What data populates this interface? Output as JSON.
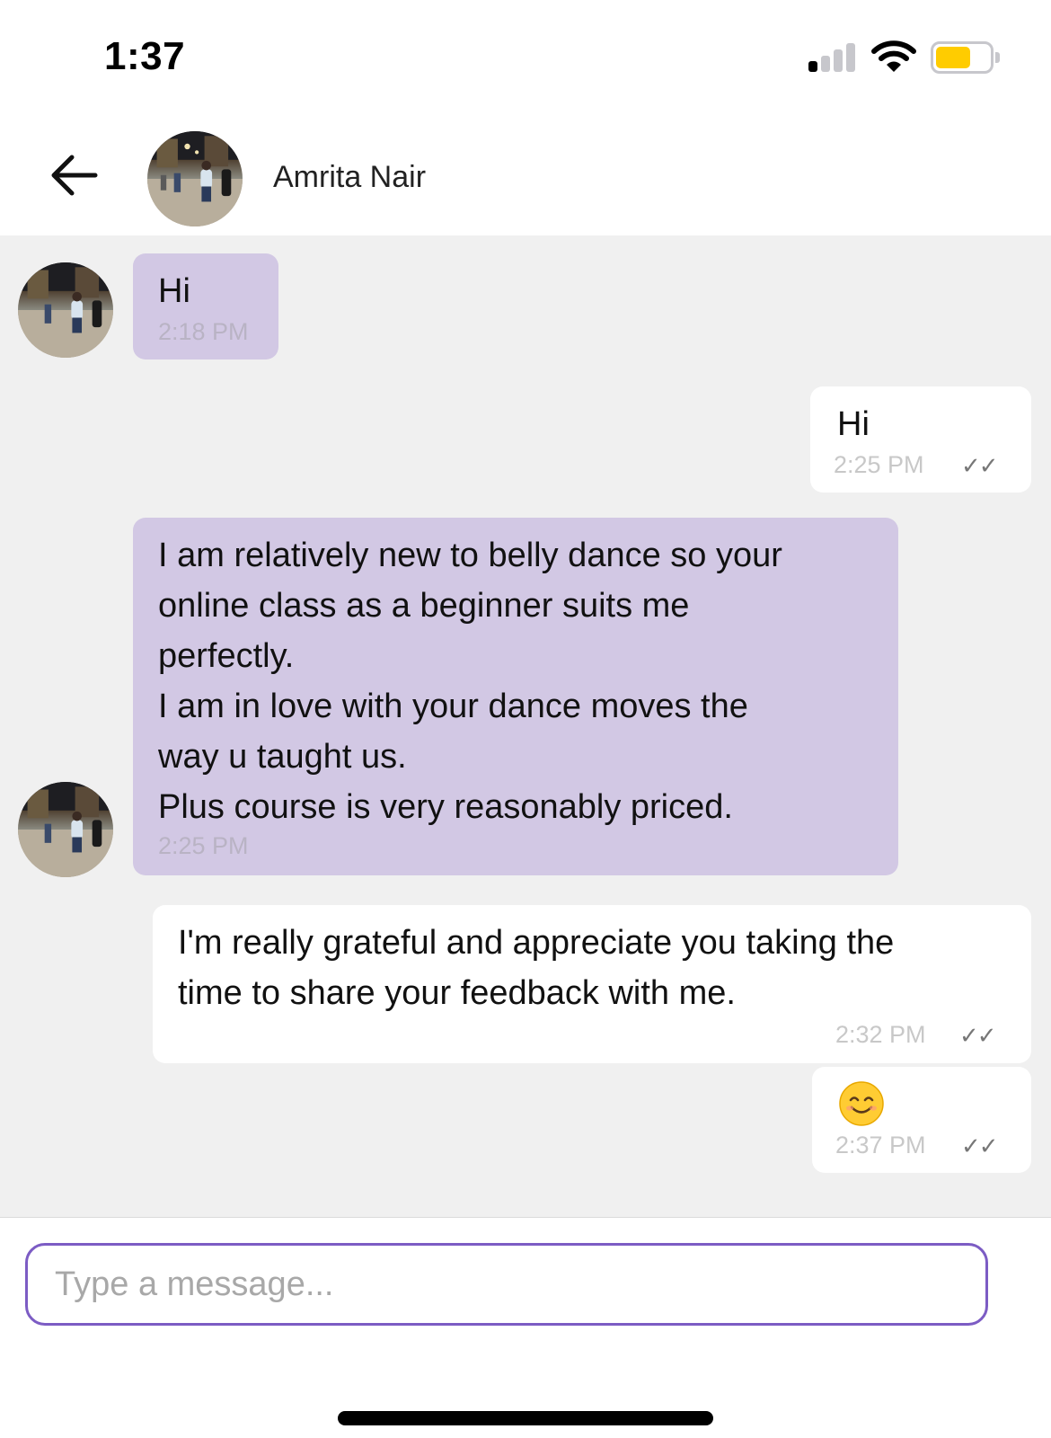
{
  "status_bar": {
    "time": "1:37",
    "signal_bars_on": 1,
    "signal_bars_total": 4,
    "battery_level": 0.65,
    "battery_color": "#ffcc00"
  },
  "header": {
    "back_icon": "arrow-left-icon",
    "contact_name": "Amrita Nair"
  },
  "messages": [
    {
      "direction": "incoming",
      "text": "Hi",
      "time": "2:18 PM"
    },
    {
      "direction": "outgoing",
      "text": "Hi",
      "time": "2:25 PM",
      "status": "✓✓"
    },
    {
      "direction": "incoming",
      "text": "I am relatively new to belly dance so your\nonline class as a beginner suits me\nperfectly.\nI am in love with your dance moves the\nway u taught us.\nPlus course is  very reasonably priced.",
      "time": "2:25 PM"
    },
    {
      "direction": "outgoing",
      "text": "I'm really grateful and appreciate you taking the\ntime to share your feedback with me.",
      "time": "2:32 PM",
      "status": "✓✓"
    },
    {
      "direction": "outgoing",
      "text": "😊",
      "time": "2:37 PM",
      "status": "✓✓"
    }
  ],
  "composer": {
    "placeholder": "Type a message...",
    "value": ""
  },
  "colors": {
    "incoming_bubble": "#d2c8e4",
    "outgoing_bubble": "#ffffff",
    "chat_background": "#f0f0f0",
    "input_border": "#7c5cc4"
  }
}
